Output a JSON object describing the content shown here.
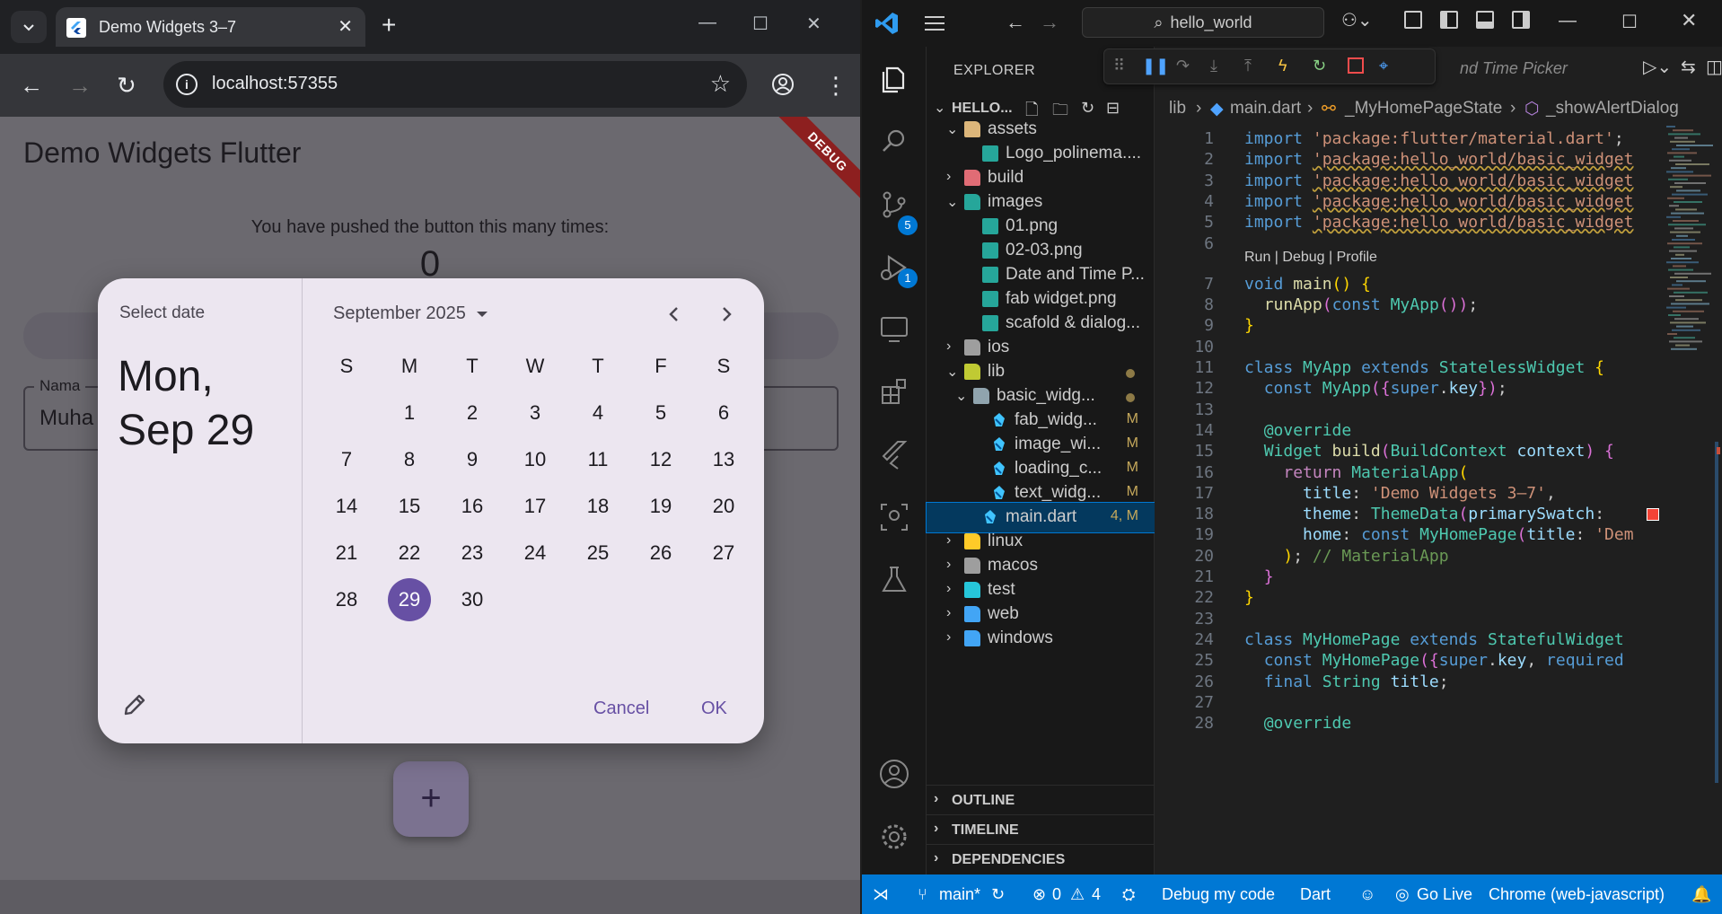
{
  "browser": {
    "tab_title": "Demo Widgets 3–7",
    "url": "localhost:57355"
  },
  "app": {
    "title": "Demo Widgets Flutter",
    "debug_banner": "DEBUG",
    "counter_label": "You have pushed the button this many times:",
    "counter_value": "0",
    "field_label": "Nama",
    "field_value": "Muha",
    "fab_label": "+"
  },
  "datepicker": {
    "header_label": "Select date",
    "selected_date": "Mon, Sep 29",
    "month_label": "September 2025",
    "weekdays": [
      "S",
      "M",
      "T",
      "W",
      "T",
      "F",
      "S"
    ],
    "days": [
      "",
      "1",
      "2",
      "3",
      "4",
      "5",
      "6",
      "7",
      "8",
      "9",
      "10",
      "11",
      "12",
      "13",
      "14",
      "15",
      "16",
      "17",
      "18",
      "19",
      "20",
      "21",
      "22",
      "23",
      "24",
      "25",
      "26",
      "27",
      "28",
      "29",
      "30"
    ],
    "selected_day": "29",
    "cancel_label": "Cancel",
    "ok_label": "OK"
  },
  "vscode": {
    "command_center": "hello_world",
    "explorer_title": "EXPLORER",
    "project_label": "HELLO...",
    "debug_tab_partial": "nd Time Picker",
    "badges": {
      "source_control": "5",
      "run_debug": "1"
    },
    "tree": [
      {
        "label": "assets",
        "type": "folder-open",
        "level": 1,
        "color": "#dcb67a"
      },
      {
        "label": "Logo_polinema....",
        "type": "image",
        "level": 2,
        "color": "#26a69a"
      },
      {
        "label": "build",
        "type": "folder",
        "level": 1,
        "color": "#e06c75"
      },
      {
        "label": "images",
        "type": "folder-open",
        "level": 1,
        "color": "#26a69a"
      },
      {
        "label": "01.png",
        "type": "image",
        "level": 2,
        "color": "#26a69a"
      },
      {
        "label": "02-03.png",
        "type": "image",
        "level": 2,
        "color": "#26a69a"
      },
      {
        "label": "Date and Time P...",
        "type": "image",
        "level": 2,
        "color": "#26a69a"
      },
      {
        "label": "fab widget.png",
        "type": "image",
        "level": 2,
        "color": "#26a69a"
      },
      {
        "label": "scafold & dialog...",
        "type": "image",
        "level": 2,
        "color": "#26a69a"
      },
      {
        "label": "ios",
        "type": "folder",
        "level": 1,
        "color": "#9e9e9e"
      },
      {
        "label": "lib",
        "type": "folder-open",
        "level": 1,
        "color": "#c0ca33",
        "dot": true
      },
      {
        "label": "basic_widg...",
        "type": "folder-open",
        "level": 2,
        "color": "#90a4ae",
        "dot": true
      },
      {
        "label": "fab_widg...",
        "type": "dart",
        "level": 3,
        "status": "M"
      },
      {
        "label": "image_wi...",
        "type": "dart",
        "level": 3,
        "status": "M"
      },
      {
        "label": "loading_c...",
        "type": "dart",
        "level": 3,
        "status": "M"
      },
      {
        "label": "text_widg...",
        "type": "dart",
        "level": 3,
        "status": "M"
      },
      {
        "label": "main.dart",
        "type": "dart",
        "level": 2,
        "status": "4, M",
        "selected": true
      },
      {
        "label": "linux",
        "type": "folder",
        "level": 1,
        "color": "#ffca28"
      },
      {
        "label": "macos",
        "type": "folder",
        "level": 1,
        "color": "#9e9e9e"
      },
      {
        "label": "test",
        "type": "folder",
        "level": 1,
        "color": "#26c6da"
      },
      {
        "label": "web",
        "type": "folder",
        "level": 1,
        "color": "#42a5f5"
      },
      {
        "label": "windows",
        "type": "folder",
        "level": 1,
        "color": "#42a5f5"
      }
    ],
    "sections": [
      "OUTLINE",
      "TIMELINE",
      "DEPENDENCIES"
    ],
    "breadcrumb": [
      "lib",
      "main.dart",
      "_MyHomePageState",
      "_showAlertDialog"
    ],
    "code_lens": "Run | Debug | Profile",
    "code_lines": [
      {
        "n": "1",
        "parts": [
          [
            "kw",
            "import "
          ],
          [
            "st",
            "'package:flutter/material.dart'"
          ],
          [
            "tx",
            ";"
          ]
        ]
      },
      {
        "n": "2",
        "parts": [
          [
            "kw",
            "import "
          ],
          [
            "st sq",
            "'package:hello_world/basic_widget"
          ]
        ]
      },
      {
        "n": "3",
        "parts": [
          [
            "kw",
            "import "
          ],
          [
            "st sq",
            "'package:hello_world/basic_widget"
          ]
        ]
      },
      {
        "n": "4",
        "parts": [
          [
            "kw",
            "import "
          ],
          [
            "st sq",
            "'package:hello_world/basic_widget"
          ]
        ]
      },
      {
        "n": "5",
        "parts": [
          [
            "kw",
            "import "
          ],
          [
            "st sq",
            "'package:hello_world/basic_widget"
          ]
        ]
      },
      {
        "n": "6",
        "parts": []
      },
      {
        "n": "7",
        "parts": [
          [
            "kw",
            "void "
          ],
          [
            "fn",
            "main"
          ],
          [
            "pu",
            "() {"
          ]
        ]
      },
      {
        "n": "8",
        "parts": [
          [
            "tx",
            "  "
          ],
          [
            "fn",
            "runApp"
          ],
          [
            "br2",
            "("
          ],
          [
            "kw",
            "const "
          ],
          [
            "ty",
            "MyApp"
          ],
          [
            "br2",
            "()"
          ],
          [
            "br2",
            ")"
          ],
          [
            "tx",
            ";"
          ]
        ]
      },
      {
        "n": "9",
        "parts": [
          [
            "pu",
            "}"
          ]
        ]
      },
      {
        "n": "10",
        "parts": []
      },
      {
        "n": "11",
        "parts": [
          [
            "kw",
            "class "
          ],
          [
            "ty",
            "MyApp "
          ],
          [
            "kw",
            "extends "
          ],
          [
            "ty",
            "StatelessWidget "
          ],
          [
            "pu",
            "{"
          ]
        ]
      },
      {
        "n": "12",
        "parts": [
          [
            "tx",
            "  "
          ],
          [
            "kw",
            "const "
          ],
          [
            "ty",
            "MyApp"
          ],
          [
            "br2",
            "({"
          ],
          [
            "kw",
            "super"
          ],
          [
            "tx",
            "."
          ],
          [
            "pr",
            "key"
          ],
          [
            "br2",
            "})"
          ],
          [
            "tx",
            ";"
          ]
        ]
      },
      {
        "n": "13",
        "parts": []
      },
      {
        "n": "14",
        "parts": [
          [
            "tx",
            "  "
          ],
          [
            "ty",
            "@override"
          ]
        ]
      },
      {
        "n": "15",
        "parts": [
          [
            "tx",
            "  "
          ],
          [
            "ty",
            "Widget "
          ],
          [
            "fn",
            "build"
          ],
          [
            "br2",
            "("
          ],
          [
            "ty",
            "BuildContext "
          ],
          [
            "pr",
            "context"
          ],
          [
            "br2",
            ") {"
          ]
        ]
      },
      {
        "n": "16",
        "parts": [
          [
            "tx",
            "    "
          ],
          [
            "kc",
            "return "
          ],
          [
            "ty",
            "MaterialApp"
          ],
          [
            "pu",
            "("
          ]
        ]
      },
      {
        "n": "17",
        "parts": [
          [
            "tx",
            "      "
          ],
          [
            "pr",
            "title"
          ],
          [
            "tx",
            ": "
          ],
          [
            "st",
            "'Demo Widgets 3–7'"
          ],
          [
            "tx",
            ","
          ]
        ]
      },
      {
        "n": "18",
        "parts": [
          [
            "tx",
            "      "
          ],
          [
            "pr",
            "theme"
          ],
          [
            "tx",
            ": "
          ],
          [
            "ty",
            "ThemeData"
          ],
          [
            "br2",
            "("
          ],
          [
            "pr",
            "primarySwatch"
          ],
          [
            "tx",
            ": "
          ]
        ]
      },
      {
        "n": "19",
        "parts": [
          [
            "tx",
            "      "
          ],
          [
            "pr",
            "home"
          ],
          [
            "tx",
            ": "
          ],
          [
            "kw",
            "const "
          ],
          [
            "ty",
            "MyHomePage"
          ],
          [
            "br2",
            "("
          ],
          [
            "pr",
            "title"
          ],
          [
            "tx",
            ": "
          ],
          [
            "st",
            "'Dem"
          ]
        ]
      },
      {
        "n": "20",
        "parts": [
          [
            "tx",
            "    "
          ],
          [
            "pu",
            ")"
          ],
          [
            "tx",
            "; "
          ],
          [
            "cm",
            "// MaterialApp"
          ]
        ]
      },
      {
        "n": "21",
        "parts": [
          [
            "tx",
            "  "
          ],
          [
            "br2",
            "}"
          ]
        ]
      },
      {
        "n": "22",
        "parts": [
          [
            "pu",
            "}"
          ]
        ]
      },
      {
        "n": "23",
        "parts": []
      },
      {
        "n": "24",
        "parts": [
          [
            "kw",
            "class "
          ],
          [
            "ty",
            "MyHomePage "
          ],
          [
            "kw",
            "extends "
          ],
          [
            "ty",
            "StatefulWidget"
          ]
        ]
      },
      {
        "n": "25",
        "parts": [
          [
            "tx",
            "  "
          ],
          [
            "kw",
            "const "
          ],
          [
            "ty",
            "MyHomePage"
          ],
          [
            "br2",
            "({"
          ],
          [
            "kw",
            "super"
          ],
          [
            "tx",
            "."
          ],
          [
            "pr",
            "key"
          ],
          [
            "tx",
            ", "
          ],
          [
            "kw",
            "required"
          ]
        ]
      },
      {
        "n": "26",
        "parts": [
          [
            "tx",
            "  "
          ],
          [
            "kw",
            "final "
          ],
          [
            "ty",
            "String "
          ],
          [
            "pr",
            "title"
          ],
          [
            "tx",
            ";"
          ]
        ]
      },
      {
        "n": "27",
        "parts": []
      },
      {
        "n": "28",
        "parts": [
          [
            "tx",
            "  "
          ],
          [
            "ty",
            "@override"
          ]
        ]
      }
    ],
    "status": {
      "branch": "main*",
      "errors": "0",
      "warnings": "4",
      "debug": "Debug my code",
      "language": "Dart",
      "golive": "Go Live",
      "device": "Chrome (web-javascript)"
    },
    "colors": {
      "accent": "#0078d4",
      "primary": "#6750a4"
    }
  }
}
